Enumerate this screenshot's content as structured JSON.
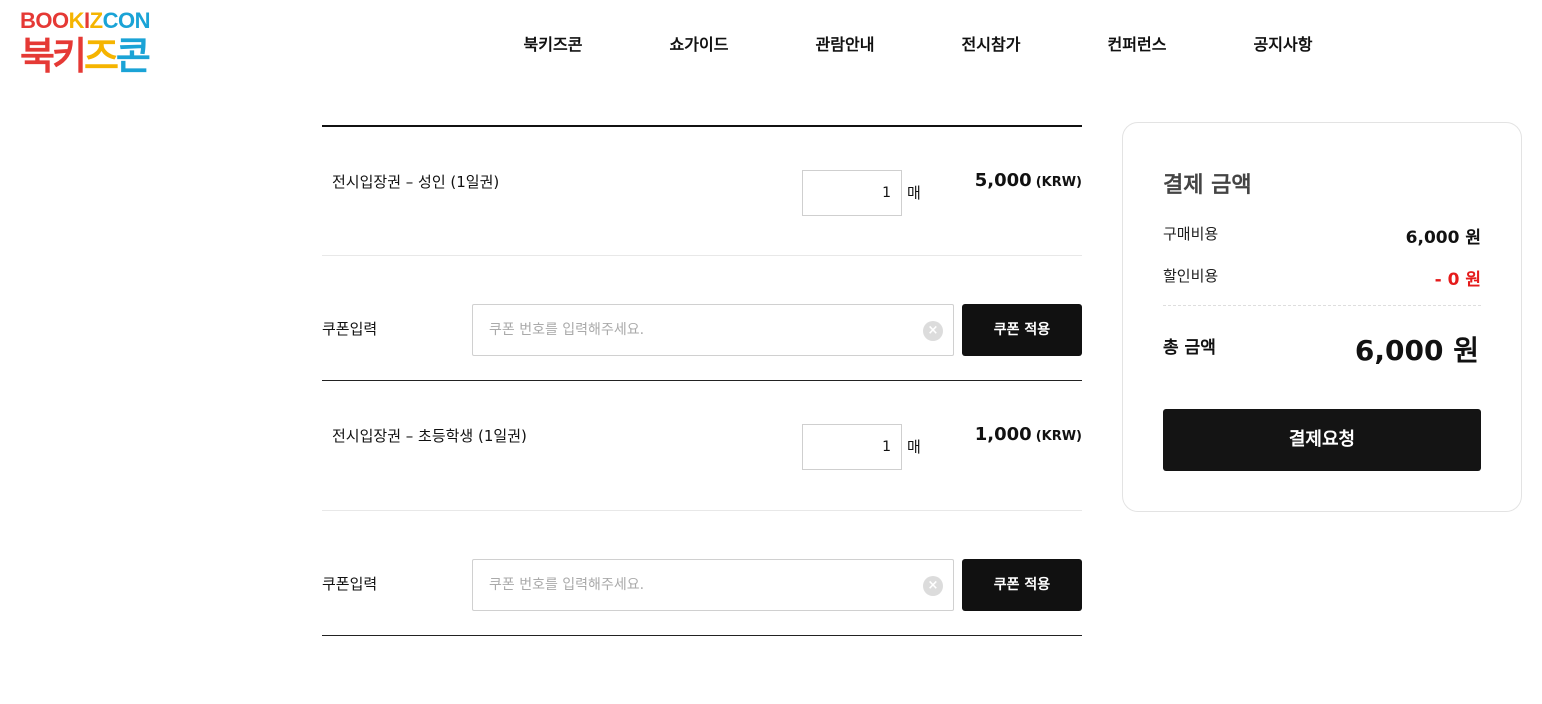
{
  "logo": {
    "top_parts": [
      "BOO",
      "K",
      "I",
      "Z",
      "CON"
    ],
    "bottom_chars": [
      "북",
      "키",
      "즈",
      "콘"
    ]
  },
  "nav": [
    "북키즈콘",
    "쇼가이드",
    "관람안내",
    "전시참가",
    "컨퍼런스",
    "공지사항"
  ],
  "tickets": [
    {
      "name": "전시입장권 – 성인 (1일권)",
      "quantity": "1",
      "unit": "매",
      "price": "5,000",
      "currency": "(KRW)",
      "coupon_label": "쿠폰입력",
      "coupon_placeholder": "쿠폰 번호를 입력해주세요.",
      "coupon_button": "쿠폰 적용"
    },
    {
      "name": "전시입장권 – 초등학생 (1일권)",
      "quantity": "1",
      "unit": "매",
      "price": "1,000",
      "currency": "(KRW)",
      "coupon_label": "쿠폰입력",
      "coupon_placeholder": "쿠폰 번호를 입력해주세요.",
      "coupon_button": "쿠폰 적용"
    }
  ],
  "summary": {
    "title": "결제 금액",
    "purchase_label": "구매비용",
    "purchase_value": "6,000 원",
    "discount_label": "할인비용",
    "discount_value": "- 0 원",
    "total_label": "총 금액",
    "total_value": "6,000 원",
    "pay_button": "결제요청"
  },
  "colors": {
    "brand_red": "#e53935",
    "brand_yellow": "#f5b400",
    "brand_blue": "#1aa3d6",
    "discount_red": "#e51b1b",
    "button_dark": "#111111"
  }
}
